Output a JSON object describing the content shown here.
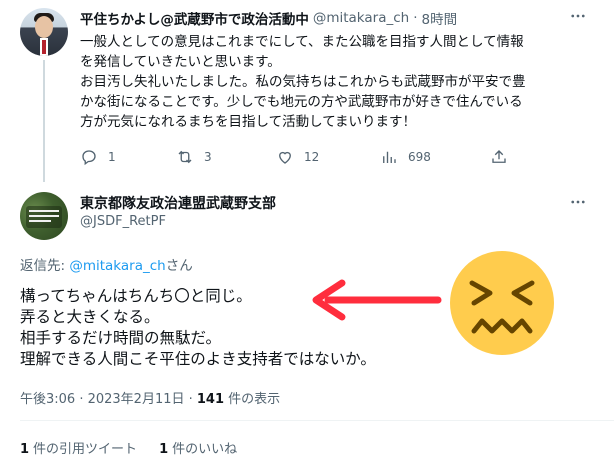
{
  "tweet1": {
    "display_name": "平住ちかよし@武蔵野市で政治活動中",
    "handle": "@mitakara_ch",
    "dot": "·",
    "time": "8時間",
    "text_lines": [
      "一般人としての意見はこれまでにして、また公職を目指す人間として情報",
      "を発信していきたいと思います。",
      "お目汚し失礼いたしました。私の気持ちはこれからも武蔵野市が平安で豊",
      "かな街になることです。少しでも地元の方や武蔵野市が好きで住んでいる",
      "方が元気になれるまちを目指して活動してまいります！"
    ],
    "actions": {
      "reply_count": "1",
      "retweet_count": "3",
      "like_count": "12",
      "views_count": "698"
    }
  },
  "tweet2": {
    "display_name": "東京都隊友政治連盟武蔵野支部",
    "handle": "@JSDF_RetPF",
    "reply_prefix": "返信先: ",
    "reply_target": "@mitakara_ch",
    "reply_suffix": "さん",
    "text_lines": [
      "構ってちゃんはちんち〇と同じ。",
      "弄ると大きくなる。",
      "相手するだけ時間の無駄だ。",
      "理解できる人間こそ平住のよき支持者ではないか。"
    ],
    "timestamp": "午後3:06 · 2023年2月11日 · ",
    "views_number": "141",
    "views_label": " 件の表示",
    "quote_count": "1",
    "quote_label": "件の引用ツイート",
    "like_count": "1",
    "like_label": "件のいいね"
  },
  "colors": {
    "text": "#0f1419",
    "secondary": "#536471",
    "link": "#1d9bf0",
    "annotation_arrow": "#ff2d3d",
    "emoji_face": "#ffcc4d"
  },
  "icons": [
    "more-icon",
    "reply-icon",
    "retweet-icon",
    "like-icon",
    "views-icon",
    "share-icon",
    "confounded-face-emoji",
    "red-arrow"
  ]
}
